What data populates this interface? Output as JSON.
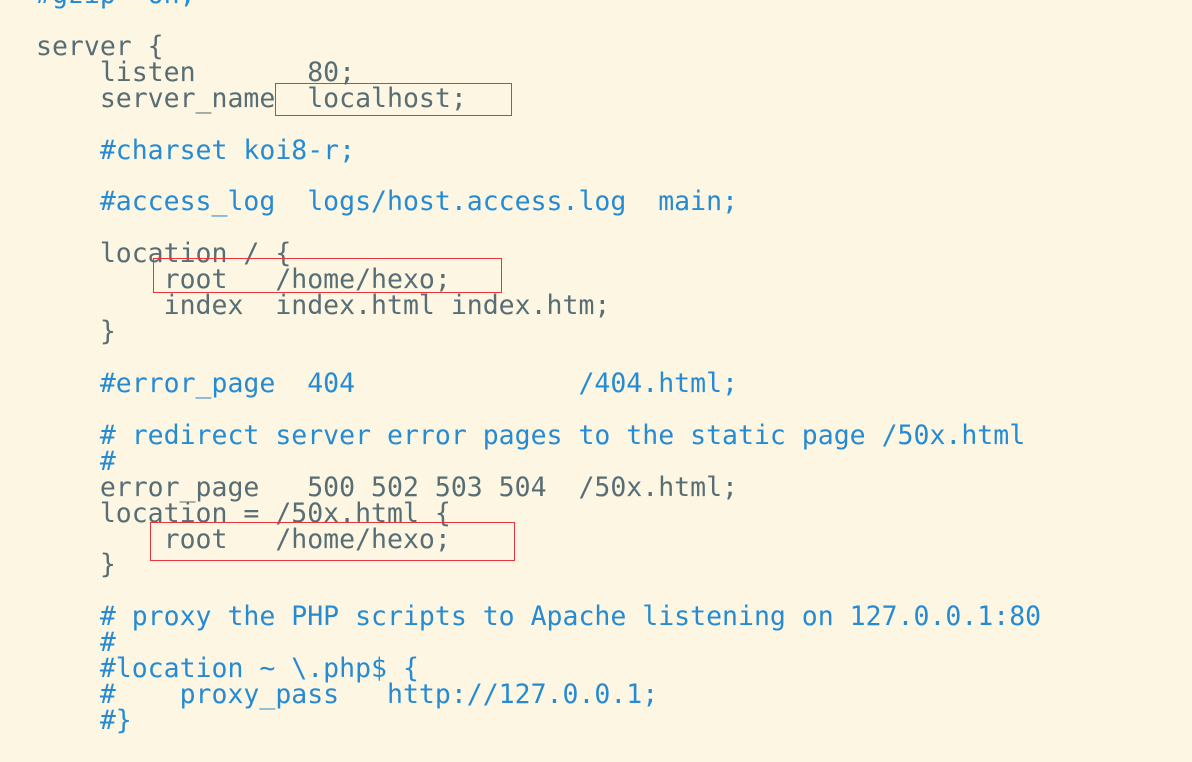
{
  "editor": {
    "background": "#fdf6e3",
    "text_color": "#586e75",
    "comment_color": "#268bd2",
    "highlight_color": "#e8343a",
    "lines": [
      {
        "text": "#gzip  on;",
        "comment": true
      },
      {
        "text": "",
        "comment": false
      },
      {
        "text": "server {",
        "comment": false
      },
      {
        "text": "    listen       80;",
        "comment": false
      },
      {
        "text": "    server_name  localhost;",
        "comment": false
      },
      {
        "text": "",
        "comment": false
      },
      {
        "text": "    #charset koi8-r;",
        "comment": true
      },
      {
        "text": "",
        "comment": false
      },
      {
        "text": "    #access_log  logs/host.access.log  main;",
        "comment": true
      },
      {
        "text": "",
        "comment": false
      },
      {
        "text": "    location / {",
        "comment": false
      },
      {
        "text": "        root   /home/hexo;",
        "comment": false
      },
      {
        "text": "        index  index.html index.htm;",
        "comment": false
      },
      {
        "text": "    }",
        "comment": false
      },
      {
        "text": "",
        "comment": false
      },
      {
        "text": "    #error_page  404              /404.html;",
        "comment": true
      },
      {
        "text": "",
        "comment": false
      },
      {
        "text": "    # redirect server error pages to the static page /50x.html",
        "comment": true
      },
      {
        "text": "    #",
        "comment": true
      },
      {
        "text": "    error_page   500 502 503 504  /50x.html;",
        "comment": false
      },
      {
        "text": "    location = /50x.html {",
        "comment": false
      },
      {
        "text": "        root   /home/hexo;",
        "comment": false
      },
      {
        "text": "    }",
        "comment": false
      },
      {
        "text": "",
        "comment": false
      },
      {
        "text": "    # proxy the PHP scripts to Apache listening on 127.0.0.1:80",
        "comment": true
      },
      {
        "text": "    #",
        "comment": true
      },
      {
        "text": "    #location ~ \\.php$ {",
        "comment": true
      },
      {
        "text": "    #    proxy_pass   http://127.0.0.1;",
        "comment": true
      },
      {
        "text": "    #}",
        "comment": true
      }
    ]
  }
}
